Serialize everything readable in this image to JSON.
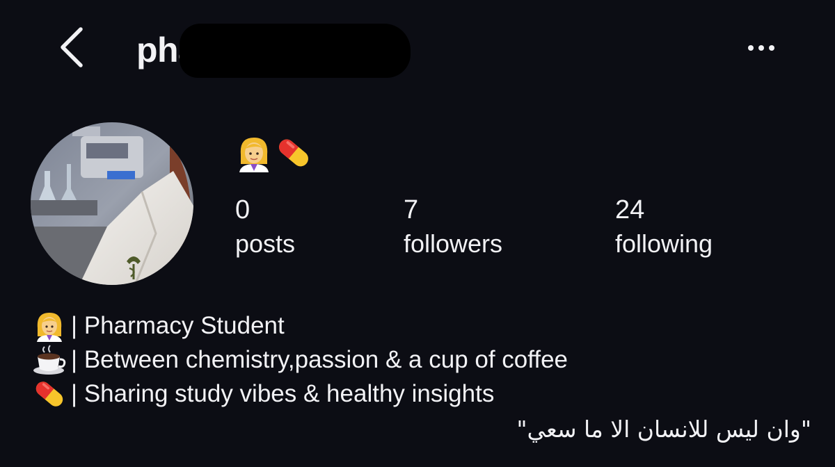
{
  "header": {
    "back_icon": "chevron-left-icon",
    "username_visible": "pha",
    "username_redacted": true,
    "more_icon": "ellipsis-icon"
  },
  "profile": {
    "avatar_icon": "lab-coat-photo",
    "name_icons": [
      "woman-health-worker-emoji",
      "pill-emoji"
    ]
  },
  "stats": {
    "posts": {
      "count": "0",
      "label": "posts"
    },
    "followers": {
      "count": "7",
      "label": "followers"
    },
    "following": {
      "count": "24",
      "label": "following"
    }
  },
  "bio": {
    "lines": [
      {
        "icon": "woman-health-worker-emoji",
        "text": "| Pharmacy Student"
      },
      {
        "icon": "hot-beverage-emoji",
        "text": "| Between chemistry,passion & a cup of coffee"
      },
      {
        "icon": "pill-emoji",
        "text": "| Sharing study vibes & healthy insights"
      }
    ],
    "quote": "\"وان ليس للانسان الا ما سعي\""
  },
  "colors": {
    "background": "#0c0d14",
    "text": "#f2f2f5",
    "pill_red": "#e5322d",
    "pill_yellow": "#f7c52b"
  }
}
